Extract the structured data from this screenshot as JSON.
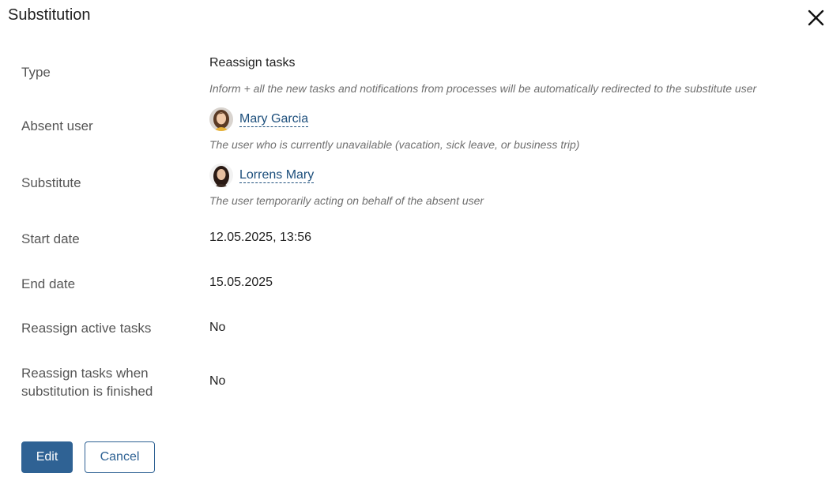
{
  "dialog": {
    "title": "Substitution",
    "close_icon": "close-icon"
  },
  "fields": {
    "type": {
      "label": "Type",
      "value": "Reassign tasks",
      "hint": "Inform + all the new tasks and notifications from processes will be automatically redirected to the substitute user"
    },
    "absent_user": {
      "label": "Absent user",
      "name": "Mary Garcia",
      "hint": "The user who is currently unavailable (vacation, sick leave, or business trip)"
    },
    "substitute": {
      "label": "Substitute",
      "name": "Lorrens Mary",
      "hint": "The user temporarily acting on behalf of the absent user"
    },
    "start_date": {
      "label": "Start date",
      "value": "12.05.2025, 13:56"
    },
    "end_date": {
      "label": "End date",
      "value": "15.05.2025"
    },
    "reassign_active": {
      "label": "Reassign active tasks",
      "value": "No"
    },
    "reassign_finished": {
      "label_line1": "Reassign tasks when",
      "label_line2": "substitution is finished",
      "value": "No"
    }
  },
  "buttons": {
    "edit": "Edit",
    "cancel": "Cancel"
  },
  "colors": {
    "primary": "#2f6294",
    "link": "#1d4f7c",
    "label": "#555555",
    "hint": "#6f6f6f"
  }
}
